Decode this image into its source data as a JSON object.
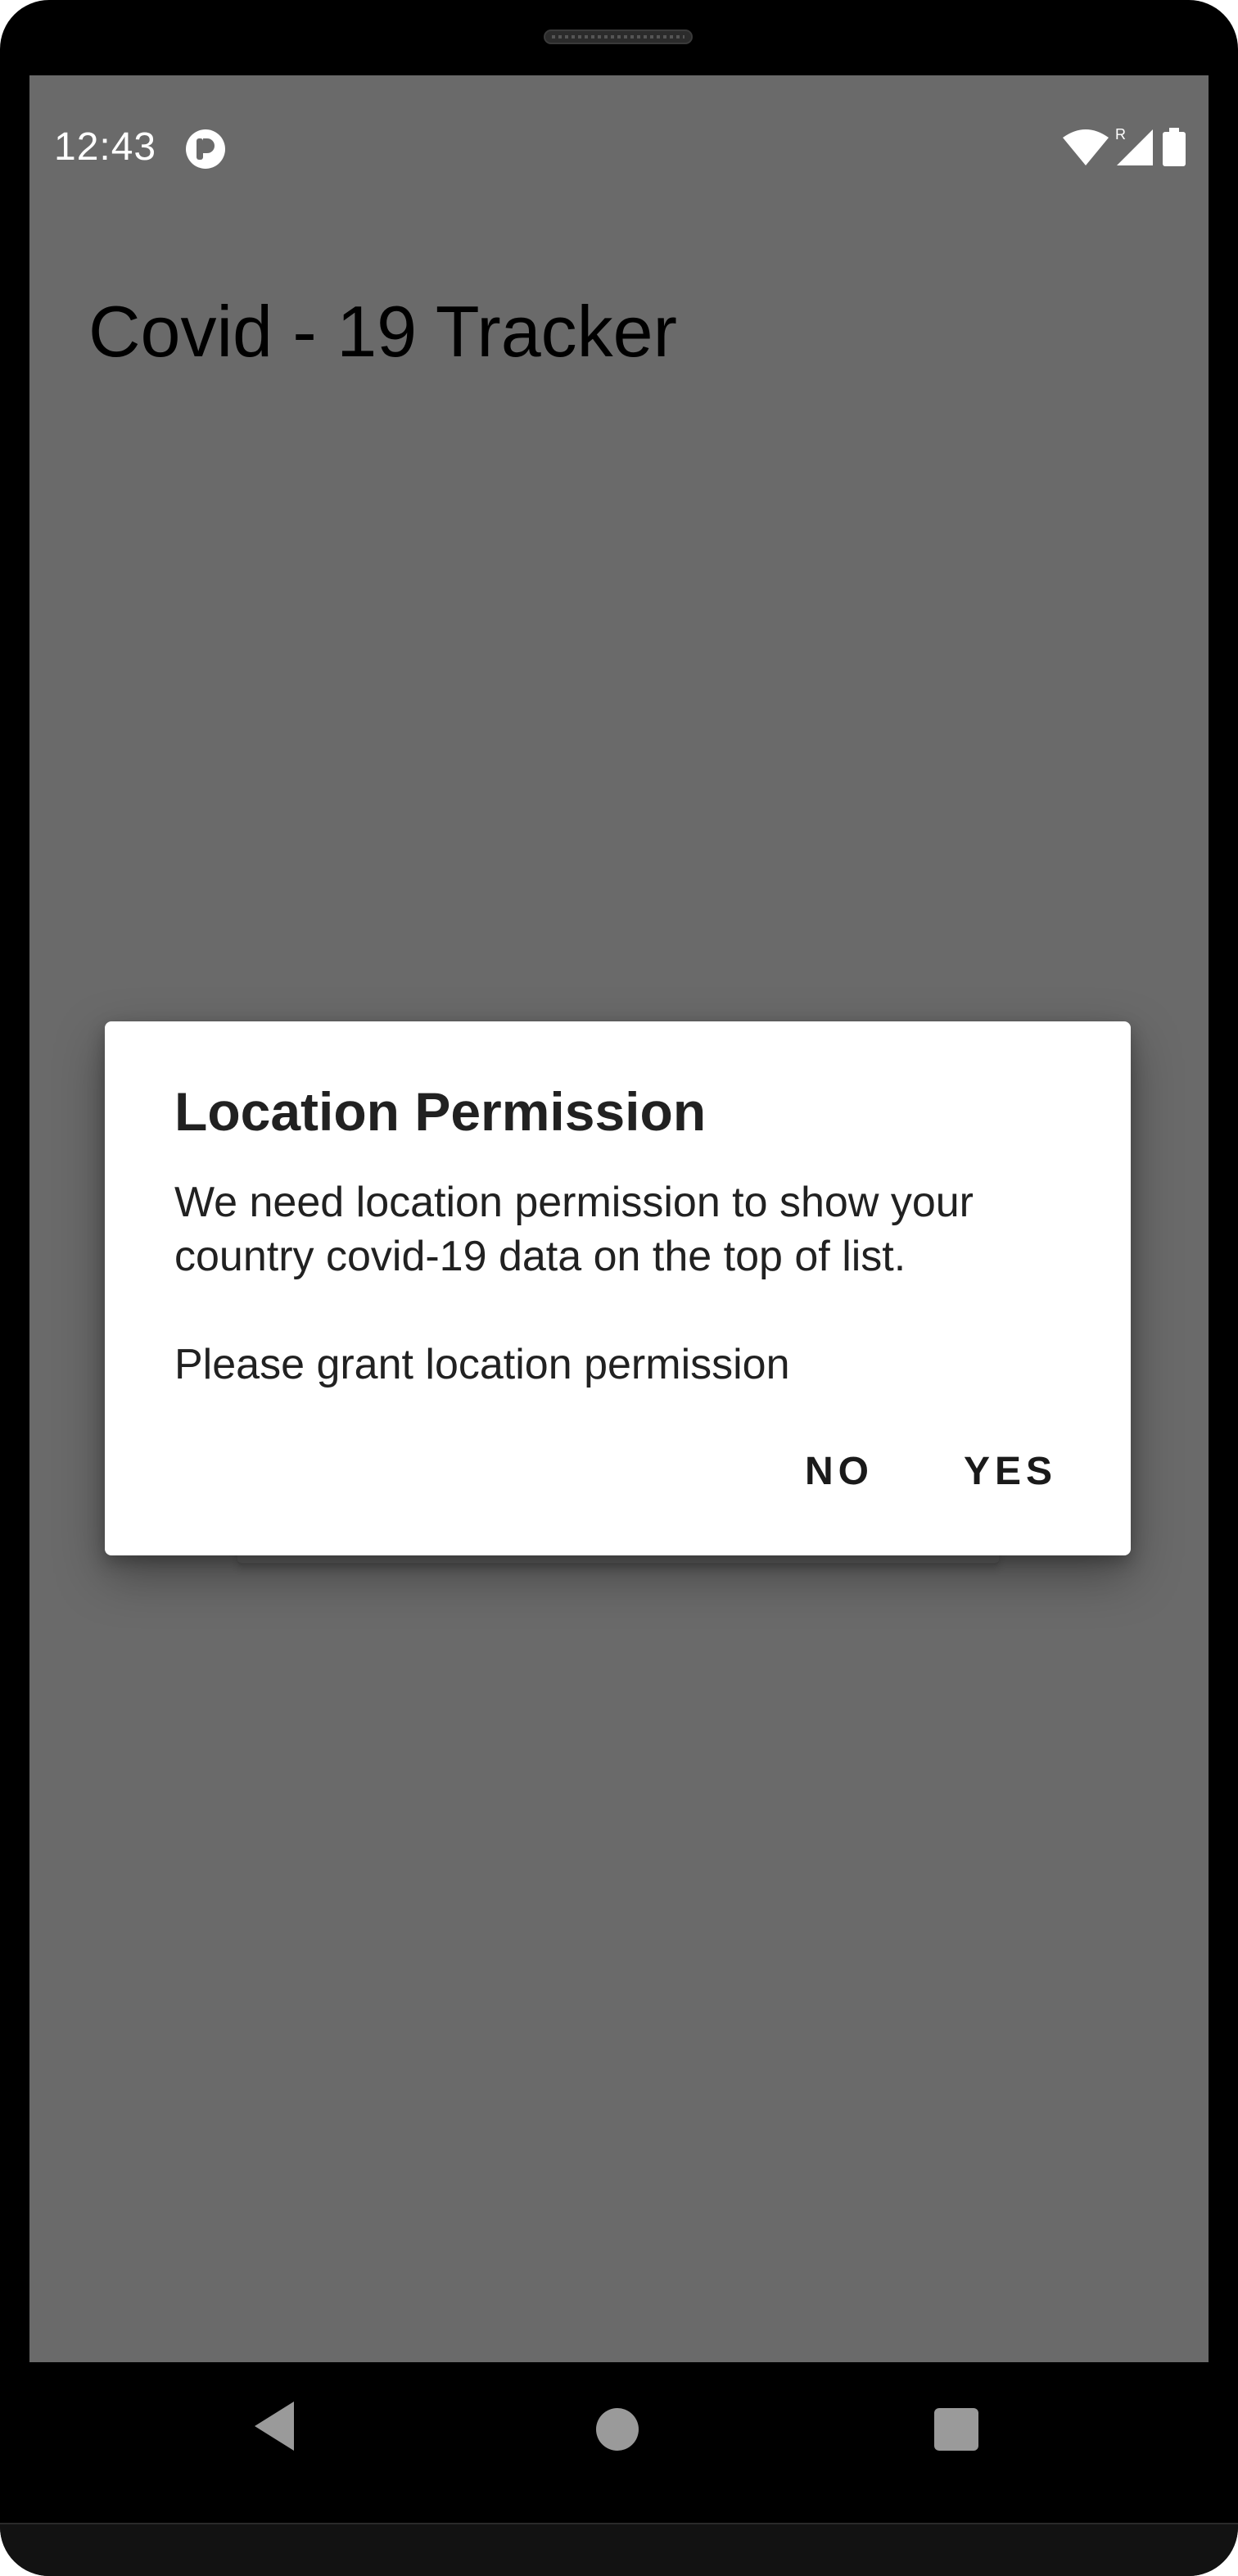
{
  "status_bar": {
    "time": "12:43",
    "network_roaming_label": "R"
  },
  "app": {
    "title": "Covid - 19 Tracker"
  },
  "dialog": {
    "title": "Location Permission",
    "message_line1": "We need location permission to show your country covid-19 data on the top of list.",
    "message_line2": "Please grant location permission",
    "negative_button": "NO",
    "positive_button": "YES"
  },
  "icons": {
    "status_app": "circle-app-icon",
    "wifi": "wifi-icon",
    "signal": "signal-icon",
    "battery": "battery-icon",
    "back": "back-icon",
    "home": "home-icon",
    "recents": "recents-icon"
  },
  "colors": {
    "scrim": "#6a6a6a",
    "dialog_bg": "#ffffff",
    "text_primary": "#212121",
    "frame": "#000000"
  }
}
